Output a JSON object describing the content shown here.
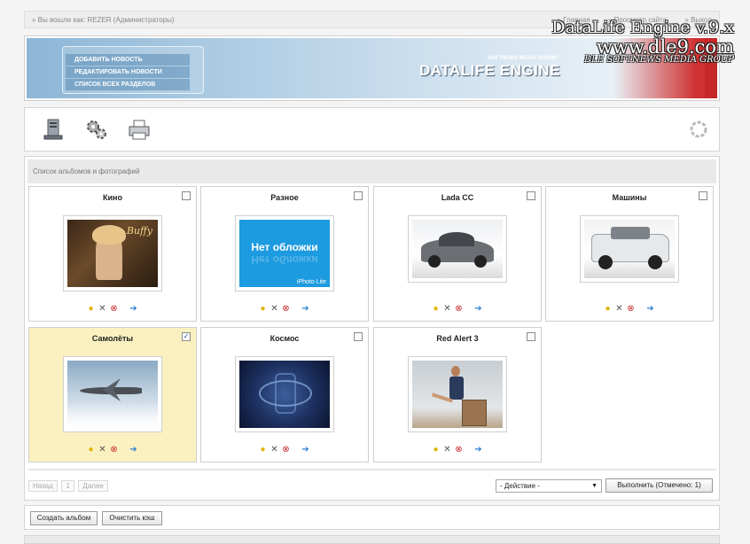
{
  "topbar": {
    "login_text": "» Вы вошли как: REZER (Администраторы)",
    "links": [
      "» Главная",
      "» Просмотр сайта",
      "» Выход"
    ]
  },
  "watermark": {
    "line1": "DataLife Engine v.9.x",
    "line2": "www.dle9.com",
    "line3": "DLE SOFTNEWS MEDIA GROUP"
  },
  "banner": {
    "menu": [
      "ДОБАВИТЬ НОВОСТЬ",
      "РЕДАКТИРОВАТЬ НОВОСТИ",
      "СПИСОК ВСЕХ РАЗДЕЛОВ"
    ],
    "logo": "DATALIFE ENGINE",
    "logo_sub": "SOFTNEWS MEDIA GROUP"
  },
  "toolbar": {
    "icons": [
      "server-icon",
      "settings-gears-icon",
      "printer-icon",
      "refresh-icon"
    ]
  },
  "panel": {
    "header": "Список альбомов и фотографий"
  },
  "albums": [
    {
      "title": "Кино",
      "checked": false,
      "thumb_text": "Buffy"
    },
    {
      "title": "Разное",
      "checked": false,
      "thumb_text": "Нет обложки",
      "thumb_caption": "iPhoto Lite"
    },
    {
      "title": "Lada CC",
      "checked": false,
      "thumb_text": ""
    },
    {
      "title": "Машины",
      "checked": false,
      "thumb_text": ""
    },
    {
      "title": "Самолёты",
      "checked": true,
      "thumb_text": ""
    },
    {
      "title": "Космос",
      "checked": false,
      "thumb_text": ""
    },
    {
      "title": "Red Alert 3",
      "checked": false,
      "thumb_text": ""
    }
  ],
  "pager": {
    "prev": "Назад",
    "page": "1",
    "next": "Далее"
  },
  "actions": {
    "select_value": "- Действие -",
    "execute_label": "Выполнить (Отмечено: 1)"
  },
  "bottom": {
    "create_album": "Создать альбом",
    "clear_cache": "Очистить кэш"
  },
  "colors": {
    "selected_bg": "#fbf1c0",
    "banner_blue": "#8db6d6",
    "banner_red": "#c62828"
  }
}
